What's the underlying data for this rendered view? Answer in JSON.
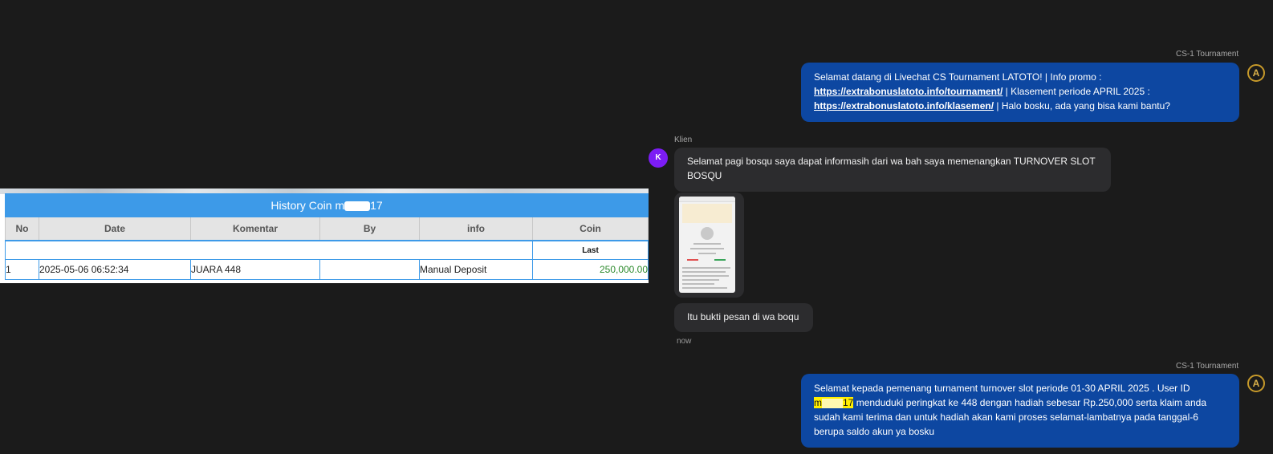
{
  "history": {
    "title_prefix": "History Coin m",
    "title_suffix": "17",
    "columns": [
      "No",
      "Date",
      "Komentar",
      "By",
      "info",
      "Coin"
    ],
    "last_label": "Last",
    "rows": [
      {
        "no": "1",
        "date": "2025-05-06 06:52:34",
        "komentar": "JUARA 448",
        "by": "",
        "info": "Manual Deposit",
        "coin": "250,000.00"
      }
    ]
  },
  "chat": {
    "agent_name": "CS-1 Tournament",
    "client_name": "Klien",
    "client_avatar_letter": "K",
    "agent_avatar_letter": "A",
    "message1": {
      "text1": "Selamat datang di Livechat CS Tournament LATOTO! | Info promo :",
      "link1": "https://extrabonuslatoto.info/tournament/",
      "text2": " | Klasement periode APRIL 2025 :",
      "link2": "https://extrabonuslatoto.info/klasemen/",
      "text3": " | Halo bosku, ada yang bisa kami bantu?"
    },
    "message2": "Selamat pagi bosqu saya dapat informasih dari wa bah saya memenangkan TURNOVER SLOT BOSQU",
    "message3": "Itu bukti pesan di wa boqu",
    "timestamp": "now",
    "message4": {
      "text1": "Selamat kepada pemenang turnament turnover slot periode 01-30 APRIL 2025 . User ID",
      "user_prefix": "m",
      "user_suffix": "17",
      "text2": " menduduki peringkat ke 448 dengan hadiah sebesar Rp.250,000 serta klaim anda sudah kami terima dan untuk hadiah akan kami proses selamat-lambatnya pada tanggal-6 berupa saldo akun ya bosku"
    }
  },
  "colors": {
    "agent_bubble": "#0d47a1",
    "client_bubble": "#2c2c2e",
    "table_header": "#3d9ae8",
    "coin_green": "#2e8b2e",
    "highlight": "#ffee00",
    "client_avatar": "#7c1cf5"
  }
}
